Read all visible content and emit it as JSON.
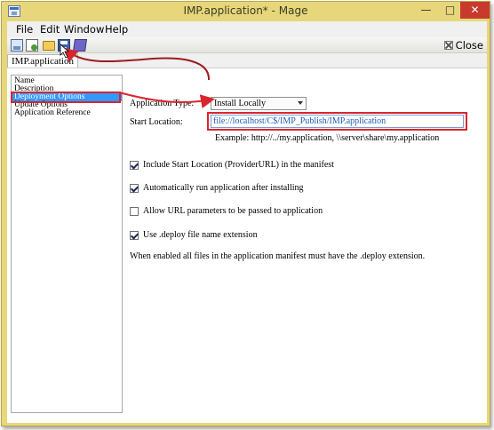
{
  "window": {
    "title": "IMP.application* - Mage",
    "controls": {
      "minimize": "—",
      "maximize": "□",
      "close": "✕"
    }
  },
  "menu": {
    "items": [
      "File",
      "Edit",
      "Window",
      "Help"
    ]
  },
  "toolbar": {
    "icons": [
      "report-icon",
      "page-icon",
      "open-folder-icon",
      "save-icon",
      "save-all-icon"
    ],
    "close_label": "Close"
  },
  "tabs": {
    "active": "IMP.application"
  },
  "nav": {
    "items": [
      "Name",
      "Description",
      "Deployment Options",
      "Update Options",
      "Application Reference"
    ],
    "selected": "Deployment Options"
  },
  "form": {
    "application_type_label": "Application Type:",
    "application_type_value": "Install Locally",
    "start_location_label": "Start Location:",
    "start_location_value": "file://localhost/C$/IMP_Publish/IMP.application",
    "example": "Example: http://../my.application, \\\\server\\share\\my.application",
    "options": [
      {
        "label": "Include Start Location (ProviderURL) in the manifest",
        "checked": true
      },
      {
        "label": "Automatically run application after installing",
        "checked": true
      },
      {
        "label": "Allow URL parameters to be passed to application",
        "checked": false
      },
      {
        "label": "Use .deploy file name extension",
        "checked": true
      }
    ],
    "note": "When enabled all files in the application manifest must have the .deploy extension."
  },
  "colors": {
    "title_bar": "#e8d77a",
    "annotation": "#d9262c",
    "selection": "#3399ff"
  }
}
